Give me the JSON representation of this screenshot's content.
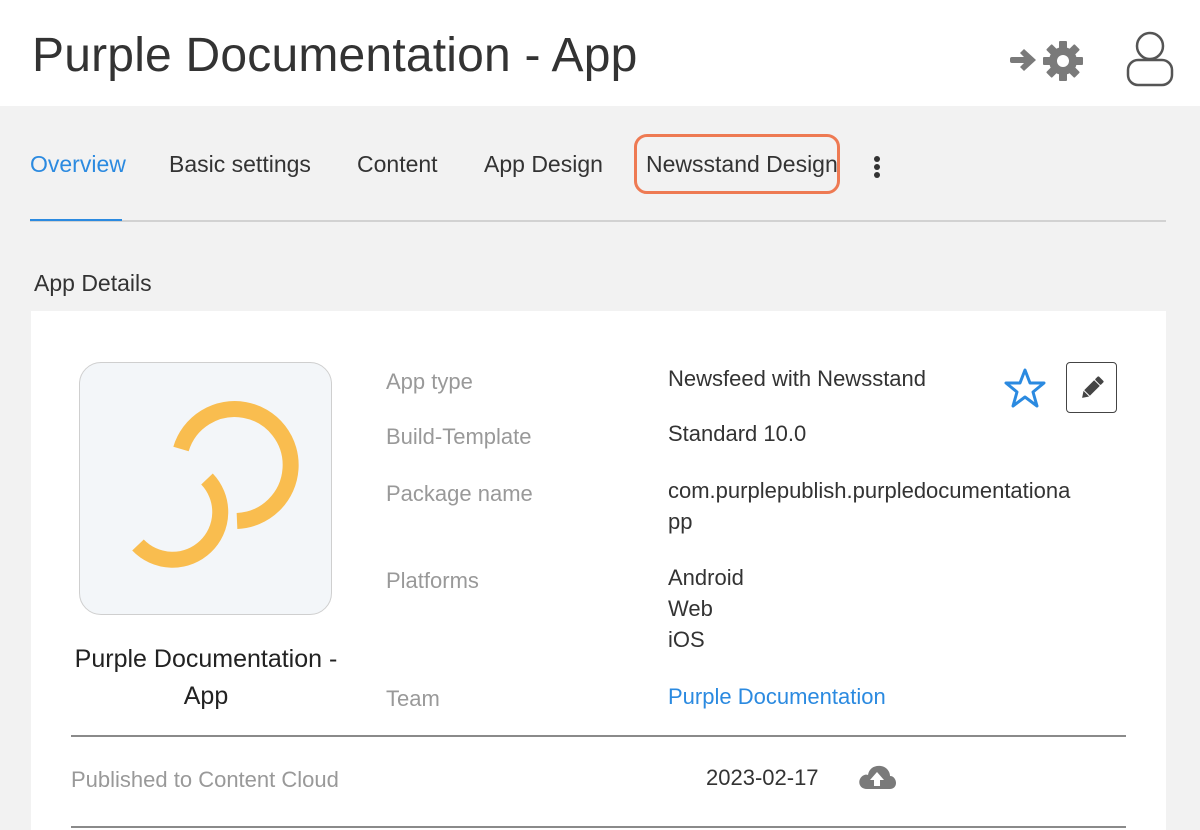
{
  "header": {
    "title": "Purple Documentation - App",
    "settings_icon": "arrow-gear-icon",
    "user_icon": "user-icon"
  },
  "tabs": [
    {
      "label": "Overview",
      "active": true
    },
    {
      "label": "Basic settings",
      "active": false
    },
    {
      "label": "Content",
      "active": false
    },
    {
      "label": "App Design",
      "active": false
    },
    {
      "label": "Newsstand Design",
      "active": false,
      "highlighted": true
    }
  ],
  "more_icon": "kebab-menu-icon",
  "section": {
    "title": "App Details"
  },
  "app": {
    "name": "Purple Documentation - App",
    "logo_color": "#f9bd4f",
    "details": {
      "app_type_label": "App type",
      "app_type_value": "Newsfeed with Newsstand",
      "build_template_label": "Build-Template",
      "build_template_value": "Standard 10.0",
      "package_label": "Package name",
      "package_value_line1": "com.purplepublish.purpledocumentationa",
      "package_value_line2": "pp",
      "platforms_label": "Platforms",
      "platforms": [
        "Android",
        "Web",
        "iOS"
      ],
      "team_label": "Team",
      "team_value": "Purple Documentation"
    },
    "published": {
      "label": "Published to Content Cloud",
      "date": "2023-02-17",
      "icon": "cloud-upload-icon"
    }
  },
  "colors": {
    "accent": "#2b8ae0",
    "highlight": "#ee7a53",
    "background": "#f2f2f2"
  }
}
